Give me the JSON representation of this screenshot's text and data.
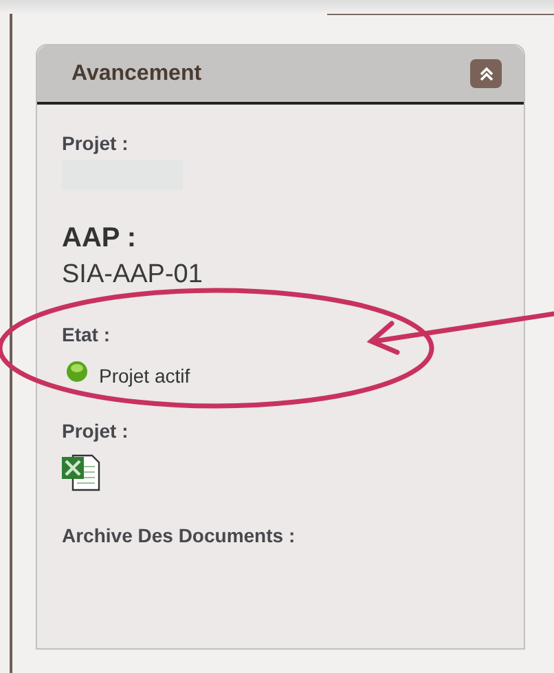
{
  "panel": {
    "title": "Avancement",
    "expanded": true,
    "sections": [
      {
        "kind": "redacted",
        "label": "Projet :"
      },
      {
        "kind": "code",
        "label": "AAP :",
        "value": "SIA-AAP-01"
      },
      {
        "kind": "status",
        "label": "Etat :",
        "value": "Projet actif",
        "active": true
      },
      {
        "kind": "file",
        "label": "Projet :"
      },
      {
        "kind": "empty",
        "label": "Archive Des Documents :"
      }
    ]
  },
  "annotation": {
    "kind": "callout"
  }
}
